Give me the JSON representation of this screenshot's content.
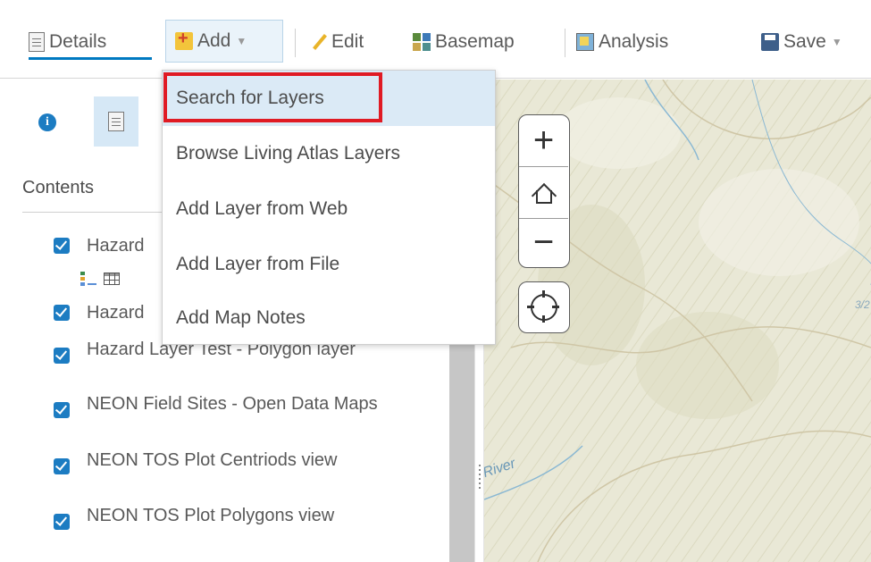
{
  "toolbar": {
    "details_label": "Details",
    "add_label": "Add",
    "edit_label": "Edit",
    "basemap_label": "Basemap",
    "analysis_label": "Analysis",
    "save_label": "Save"
  },
  "panel": {
    "contents_title": "Contents",
    "layers": [
      {
        "label": "Hazard",
        "checked": true
      },
      {
        "label": "Hazard",
        "checked": true
      },
      {
        "label": "Hazard Layer Test - Polygon layer",
        "checked": true
      },
      {
        "label": "NEON Field Sites - Open Data Maps",
        "checked": true
      },
      {
        "label": "NEON TOS Plot Centriods view",
        "checked": true
      },
      {
        "label": "NEON TOS Plot Polygons view",
        "checked": true
      }
    ]
  },
  "add_menu": {
    "items": [
      {
        "label": "Search for Layers",
        "active": true
      },
      {
        "label": "Browse Living Atlas Layers"
      },
      {
        "label": "Add Layer from Web"
      },
      {
        "label": "Add Layer from File"
      },
      {
        "label": "Add Map Notes"
      }
    ]
  },
  "map": {
    "label_river": "River",
    "label_partial": "3/2",
    "zoom_in": "+",
    "zoom_out": "−"
  },
  "colors": {
    "accent": "#0079c1",
    "checkbox": "#1c7cc2",
    "highlight_box": "#e01b24",
    "menu_active_bg": "#dbeaf6",
    "map_base": "#e8e7d4"
  }
}
